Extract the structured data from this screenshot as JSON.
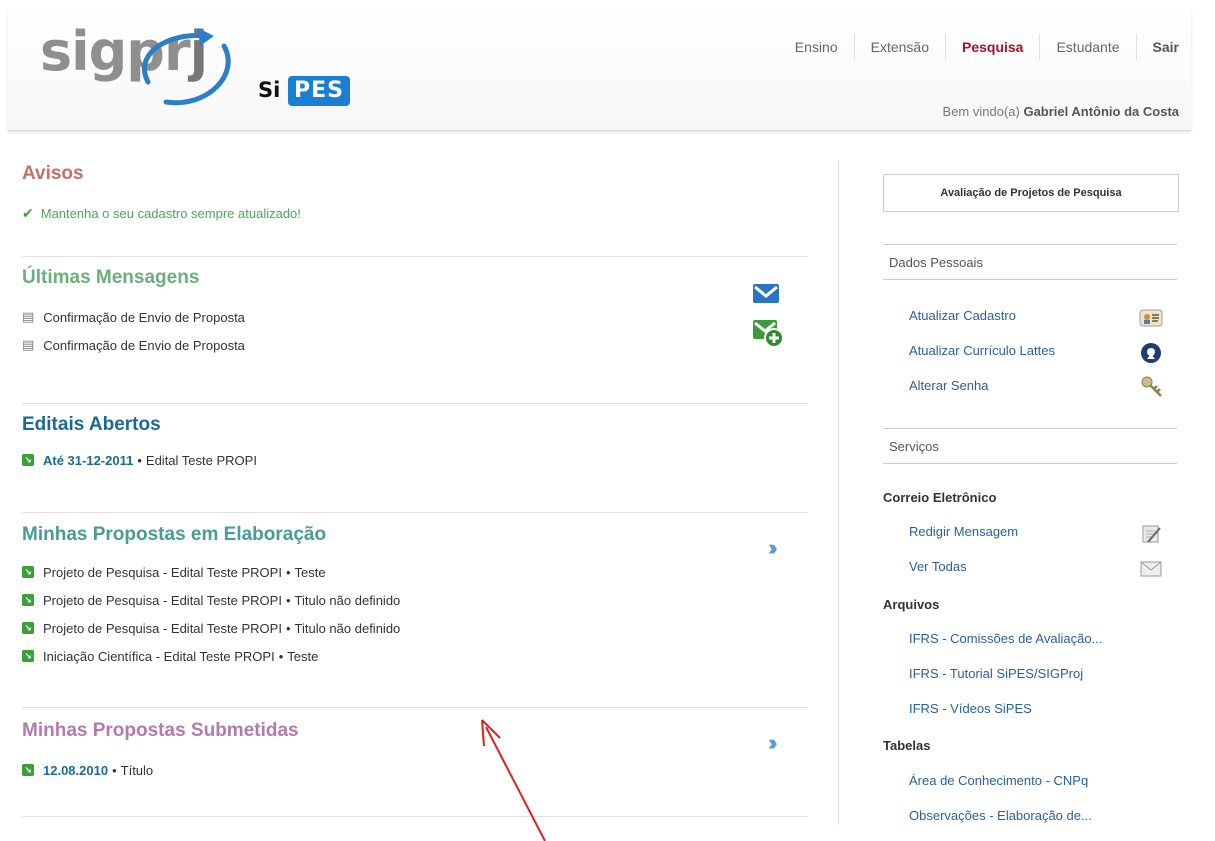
{
  "topnav": {
    "items": [
      "Ensino",
      "Extensão",
      "Pesquisa",
      "Estudante"
    ],
    "exit": "Sair",
    "active_color": "#a4142b"
  },
  "logo": {
    "text_main": "sigpr",
    "text_j": "j",
    "text_si": "Si",
    "text_pes": "PES"
  },
  "welcome": {
    "prefix": "Bem vindo(a)",
    "user": "Gabriel Antônio da Costa"
  },
  "main": {
    "avisos": {
      "title": "Avisos",
      "color": "#c0706c",
      "items": [
        "Mantenha o seu cadastro sempre atualizado!"
      ]
    },
    "mensagens": {
      "title": "Últimas Mensagens",
      "color": "#6cae7e",
      "items": [
        "Confirmação de Envio de Proposta",
        "Confirmação de Envio de Proposta"
      ]
    },
    "editais": {
      "title": "Editais Abertos",
      "color": "#1a6a98",
      "items": [
        {
          "date": "Até 31-12-2011",
          "name": "Edital Teste PROPI"
        }
      ]
    },
    "elaboracao": {
      "title": "Minhas Propostas em Elaboração",
      "color": "#4a9c96",
      "items": [
        {
          "name": "Projeto de Pesquisa - Edital Teste PROPI",
          "detail": "Teste"
        },
        {
          "name": "Projeto de Pesquisa - Edital Teste PROPI",
          "detail": "Titulo não definido"
        },
        {
          "name": "Projeto de Pesquisa - Edital Teste PROPI",
          "detail": "Titulo não definido"
        },
        {
          "name": "Iniciação Científica - Edital Teste PROPI",
          "detail": "Teste"
        }
      ]
    },
    "submetidas": {
      "title": "Minhas Propostas Submetidas",
      "color": "#b27bb0",
      "items": [
        {
          "date": "12.08.2010",
          "name": "Título"
        }
      ]
    },
    "more_icon": "double-chevron-right-icon"
  },
  "sidebar": {
    "eval_button": "Avaliação de Projetos de Pesquisa",
    "dados_pessoais": {
      "title": "Dados Pessoais",
      "links": [
        "Atualizar Cadastro",
        "Atualizar Currículo Lattes",
        "Alterar Senha"
      ]
    },
    "servicos": {
      "title": "Serviços",
      "correio": {
        "label": "Correio Eletrônico",
        "links": [
          "Redigir Mensagem",
          "Ver Todas"
        ]
      },
      "arquivos": {
        "label": "Arquivos",
        "links": [
          "IFRS - Comissões de Avaliação...",
          "IFRS - Tutorial SiPES/SIGProj",
          "IFRS - Vídeos SiPES"
        ]
      },
      "tabelas": {
        "label": "Tabelas",
        "links": [
          "Área de Conhecimento - CNPq",
          "Observações - Elaboração de..."
        ]
      }
    }
  }
}
